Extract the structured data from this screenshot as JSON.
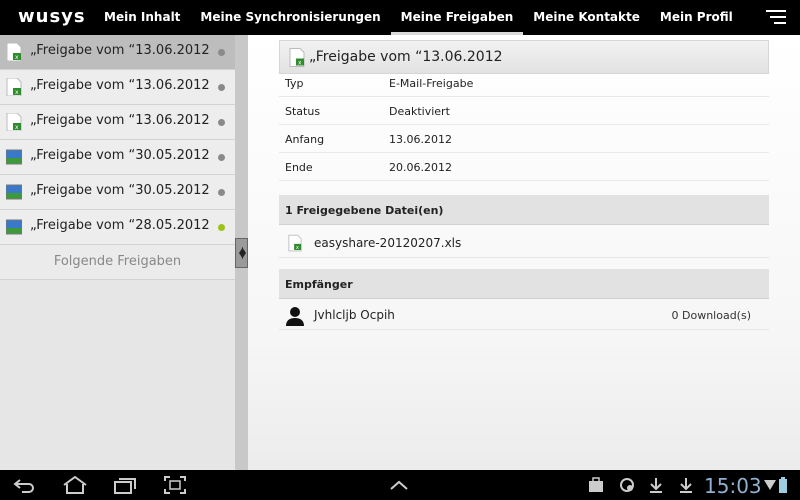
{
  "app": {
    "logo": "wusys",
    "nav": [
      {
        "label": "Mein Inhalt"
      },
      {
        "label": "Meine Synchronisierungen"
      },
      {
        "label": "Meine Freigaben"
      },
      {
        "label": "Meine Kontakte"
      },
      {
        "label": "Mein Profil"
      }
    ],
    "active_nav": "Meine Freigaben"
  },
  "sidebar": {
    "items": [
      {
        "label": "„Freigabe vom “13.06.2012",
        "icon": "excel-file-icon",
        "status": "gray",
        "selected": true
      },
      {
        "label": "„Freigabe vom “13.06.2012",
        "icon": "excel-file-icon",
        "status": "gray"
      },
      {
        "label": "„Freigabe vom “13.06.2012",
        "icon": "excel-file-icon",
        "status": "gray"
      },
      {
        "label": "„Freigabe vom “30.05.2012",
        "icon": "image-file-icon",
        "status": "gray"
      },
      {
        "label": "„Freigabe vom “30.05.2012",
        "icon": "image-file-icon",
        "status": "gray"
      },
      {
        "label": "„Freigabe vom “28.05.2012",
        "icon": "image-file-icon",
        "status": "green"
      }
    ],
    "more_label": "Folgende Freigaben"
  },
  "detail": {
    "title": "„Freigabe vom “13.06.2012",
    "rows": [
      {
        "key": "Typ",
        "value": "E-Mail-Freigabe"
      },
      {
        "key": "Status",
        "value": "Deaktiviert"
      },
      {
        "key": "Anfang",
        "value": "13.06.2012"
      },
      {
        "key": "Ende",
        "value": "20.06.2012"
      }
    ],
    "files_section": "1 Freigegebene Datei(en)",
    "file_name": "easyshare-20120207.xls",
    "recipients_section": "Empfänger",
    "recipient_name": "Jvhlcljb Ocpih",
    "recipient_downloads": "0 Download(s)"
  },
  "system": {
    "time": "15:03"
  },
  "colors": {
    "status_green": "#9bc417",
    "status_gray": "#8a8a8a",
    "clock": "#8fb0d0"
  }
}
